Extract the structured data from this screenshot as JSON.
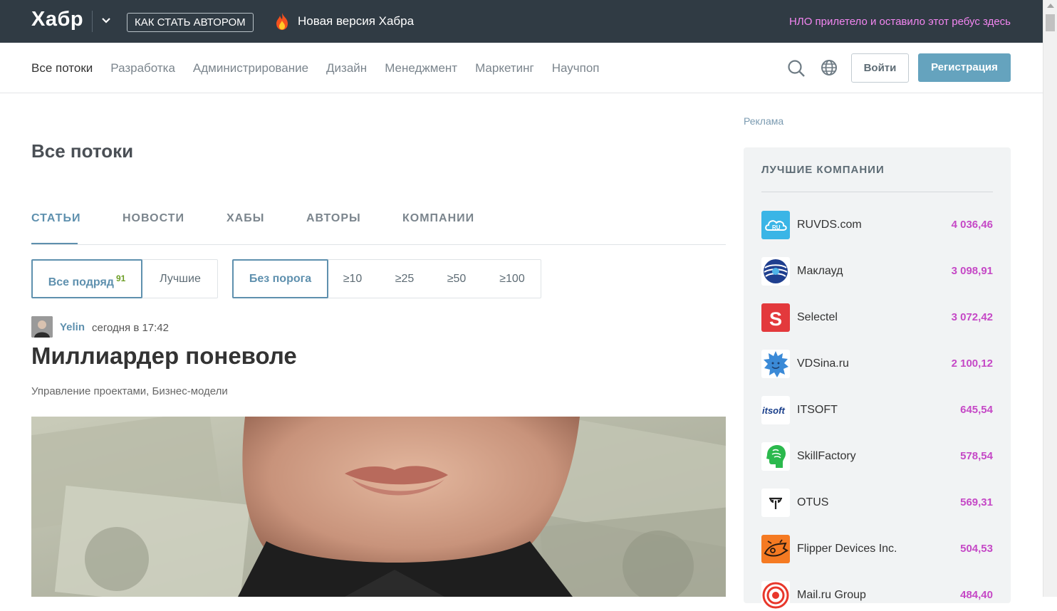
{
  "topbar": {
    "logo": "Хабр",
    "author_button": "КАК СТАТЬ АВТОРОМ",
    "new_version": "Новая версия Хабра",
    "ufo_link": "НЛО прилетело и оставило этот ребус здесь"
  },
  "nav": {
    "items": [
      "Все потоки",
      "Разработка",
      "Администрирование",
      "Дизайн",
      "Менеджмент",
      "Маркетинг",
      "Научпоп"
    ],
    "login": "Войти",
    "register": "Регистрация"
  },
  "main": {
    "title": "Все потоки",
    "tabs": [
      "СТАТЬИ",
      "НОВОСТИ",
      "ХАБЫ",
      "АВТОРЫ",
      "КОМПАНИИ"
    ],
    "filters_sort": [
      {
        "label": "Все подряд",
        "count": "91"
      },
      {
        "label": "Лучшие"
      }
    ],
    "filters_threshold": [
      "Без порога",
      "≥10",
      "≥25",
      "≥50",
      "≥100"
    ],
    "post": {
      "author": "Yelin",
      "time": "сегодня в 17:42",
      "title": "Миллиардер поневоле",
      "hubs": "Управление проектами,  Бизнес-модели"
    }
  },
  "sidebar": {
    "ad_label": "Реклама",
    "companies_title": "ЛУЧШИЕ КОМПАНИИ",
    "companies": [
      {
        "name": "RUVDS.com",
        "rating": "4 036,46",
        "color": "#3ab5e6"
      },
      {
        "name": "Маклауд",
        "rating": "3 098,91",
        "color": "#1f3f8f"
      },
      {
        "name": "Selectel",
        "rating": "3 072,42",
        "color": "#e3393c"
      },
      {
        "name": "VDSina.ru",
        "rating": "2 100,12",
        "color": "#3b8ad7"
      },
      {
        "name": "ITSOFT",
        "rating": "645,54",
        "color": "#ffffff"
      },
      {
        "name": "SkillFactory",
        "rating": "578,54",
        "color": "#2bb94d"
      },
      {
        "name": "OTUS",
        "rating": "569,31",
        "color": "#ffffff"
      },
      {
        "name": "Flipper Devices Inc.",
        "rating": "504,53",
        "color": "#f57a22"
      },
      {
        "name": "Mail.ru Group",
        "rating": "484,40",
        "color": "#ffffff"
      }
    ]
  }
}
